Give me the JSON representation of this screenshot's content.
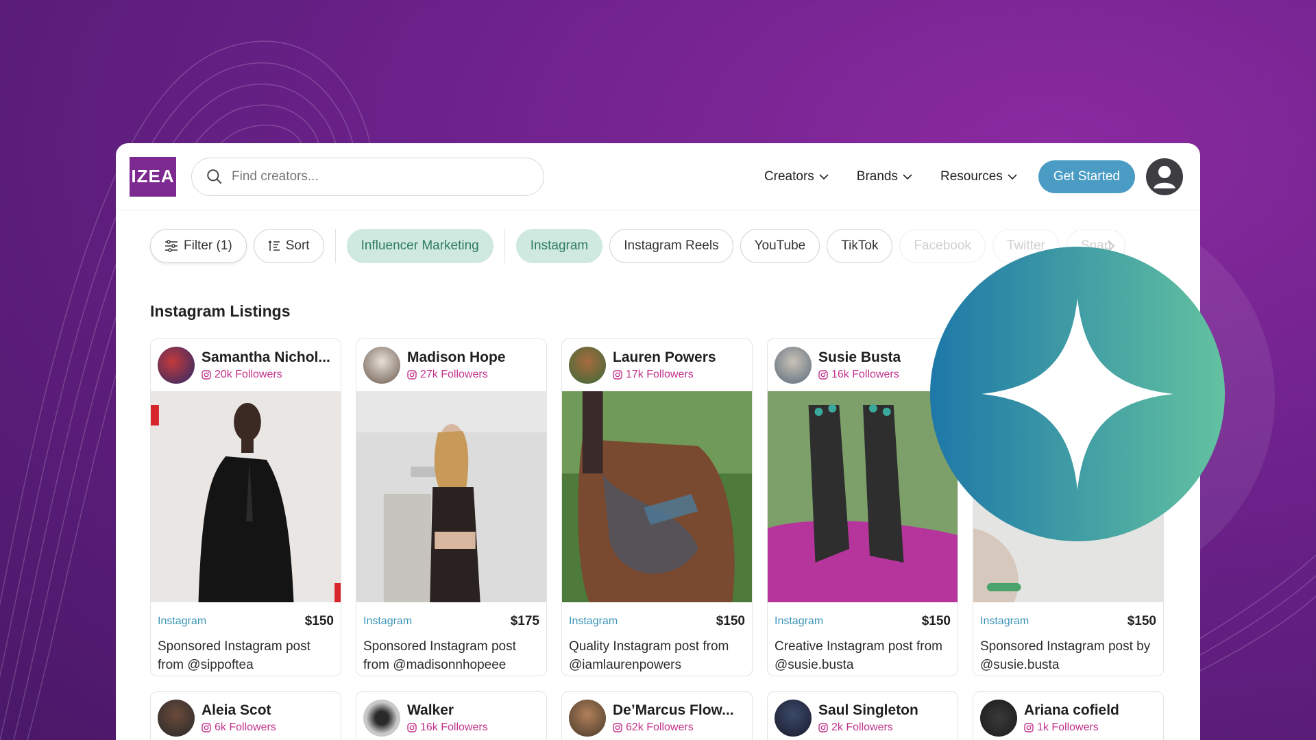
{
  "header": {
    "logo_text": "IZEA",
    "search_placeholder": "Find creators...",
    "nav": [
      {
        "label": "Creators"
      },
      {
        "label": "Brands"
      },
      {
        "label": "Resources"
      }
    ],
    "cta_label": "Get Started"
  },
  "filters": {
    "filter_label": "Filter (1)",
    "sort_label": "Sort",
    "category": "Influencer Marketing",
    "platforms": [
      "Instagram",
      "Instagram Reels",
      "YouTube",
      "TikTok",
      "Facebook",
      "Twitter",
      "Snap"
    ]
  },
  "section_title": "Instagram Listings",
  "listings": [
    {
      "name": "Samantha Nichol...",
      "followers": "20k Followers",
      "platform": "Instagram",
      "price": "$150",
      "desc": "Sponsored Instagram post from @sippoftea"
    },
    {
      "name": "Madison Hope",
      "followers": "27k Followers",
      "platform": "Instagram",
      "price": "$175",
      "desc": "Sponsored Instagram post from @madisonnhopeee"
    },
    {
      "name": "Lauren Powers",
      "followers": "17k Followers",
      "platform": "Instagram",
      "price": "$150",
      "desc": "Quality Instagram post from @iamlaurenpowers"
    },
    {
      "name": "Susie Busta",
      "followers": "16k Followers",
      "platform": "Instagram",
      "price": "$150",
      "desc": "Creative Instagram post from @susie.busta"
    },
    {
      "name": "",
      "followers": "",
      "platform": "Instagram",
      "price": "$150",
      "desc": "Sponsored Instagram post by @susie.busta"
    }
  ],
  "listings_row2": [
    {
      "name": "Aleia Scot",
      "followers": "6k Followers"
    },
    {
      "name": "Walker",
      "followers": "16k Followers"
    },
    {
      "name": "De’Marcus Flow...",
      "followers": "62k Followers"
    },
    {
      "name": "Saul Singleton",
      "followers": "2k Followers"
    },
    {
      "name": "Ariana cofield",
      "followers": "1k Followers"
    }
  ],
  "colors": {
    "brand_purple": "#7c2a8f",
    "cta_blue": "#4a9cc4",
    "followers_pink": "#c2338b",
    "platform_blue": "#3a95b8",
    "active_chip_bg": "#cfe9e0"
  },
  "icons": [
    "search-icon",
    "chevron-down-icon",
    "user-icon",
    "filter-icon",
    "sort-icon",
    "instagram-icon",
    "chevron-right-icon",
    "sparkle-icon"
  ]
}
